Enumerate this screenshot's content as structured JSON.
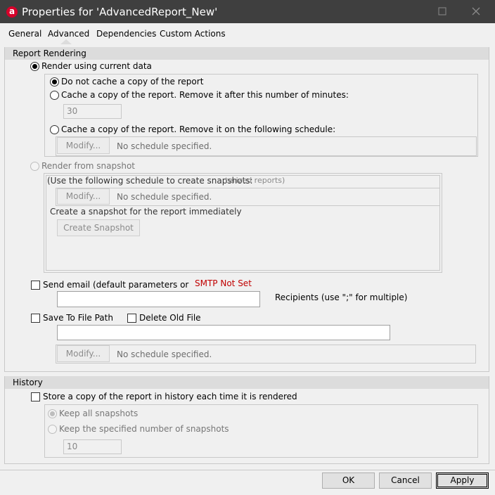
{
  "window": {
    "title": "Properties for 'AdvancedReport_New'",
    "app_icon_letter": "a",
    "titlebar_color": "#3f3f3f",
    "accent_color": "#d6002a"
  },
  "tabs": [
    {
      "label": "General"
    },
    {
      "label": "Advanced",
      "selected": true
    },
    {
      "label": "Dependencies"
    },
    {
      "label": "Custom Actions"
    }
  ],
  "report_rendering": {
    "header": "Report Rendering",
    "render_current": {
      "label": "Render using current data",
      "checked": true,
      "no_cache_label": "Do not cache a copy of the report",
      "cache_minutes_label": "Cache a copy of the report. Remove it after this number of minutes:",
      "minutes_value": "30",
      "cache_schedule_label": "Cache a copy of the report. Remove it on the following schedule:",
      "modify_label": "Modify...",
      "schedule_status": "No schedule specified."
    },
    "render_snapshot": {
      "label": "Render from snapshot",
      "use_schedule_label": "(Use the following schedule to create snapshots:",
      "overlap_text": "terized reports)",
      "modify_label": "Modify...",
      "schedule_status": "No schedule specified.",
      "create_now_label": "Create a snapshot for the report immediately",
      "create_button": "Create Snapshot"
    },
    "send_email": {
      "label": "Send email (default parameters or",
      "smtp_status": "SMTP Not Set",
      "smtp_color": "#c00000",
      "recipients_value": "",
      "recipients_label": "Recipients (use \";\" for multiple)"
    },
    "save_file": {
      "label": "Save To File Path",
      "delete_old_label": "Delete Old File",
      "path_value": "",
      "modify_label": "Modify...",
      "schedule_status": "No schedule specified."
    }
  },
  "history": {
    "header": "History",
    "store_label": "Store a copy of the report in history each time it is rendered",
    "keep_all_label": "Keep all snapshots",
    "keep_number_label": "Keep the specified number of snapshots",
    "number_value": "10"
  },
  "footer": {
    "ok_label": "OK",
    "cancel_label": "Cancel",
    "apply_label": "Apply"
  }
}
